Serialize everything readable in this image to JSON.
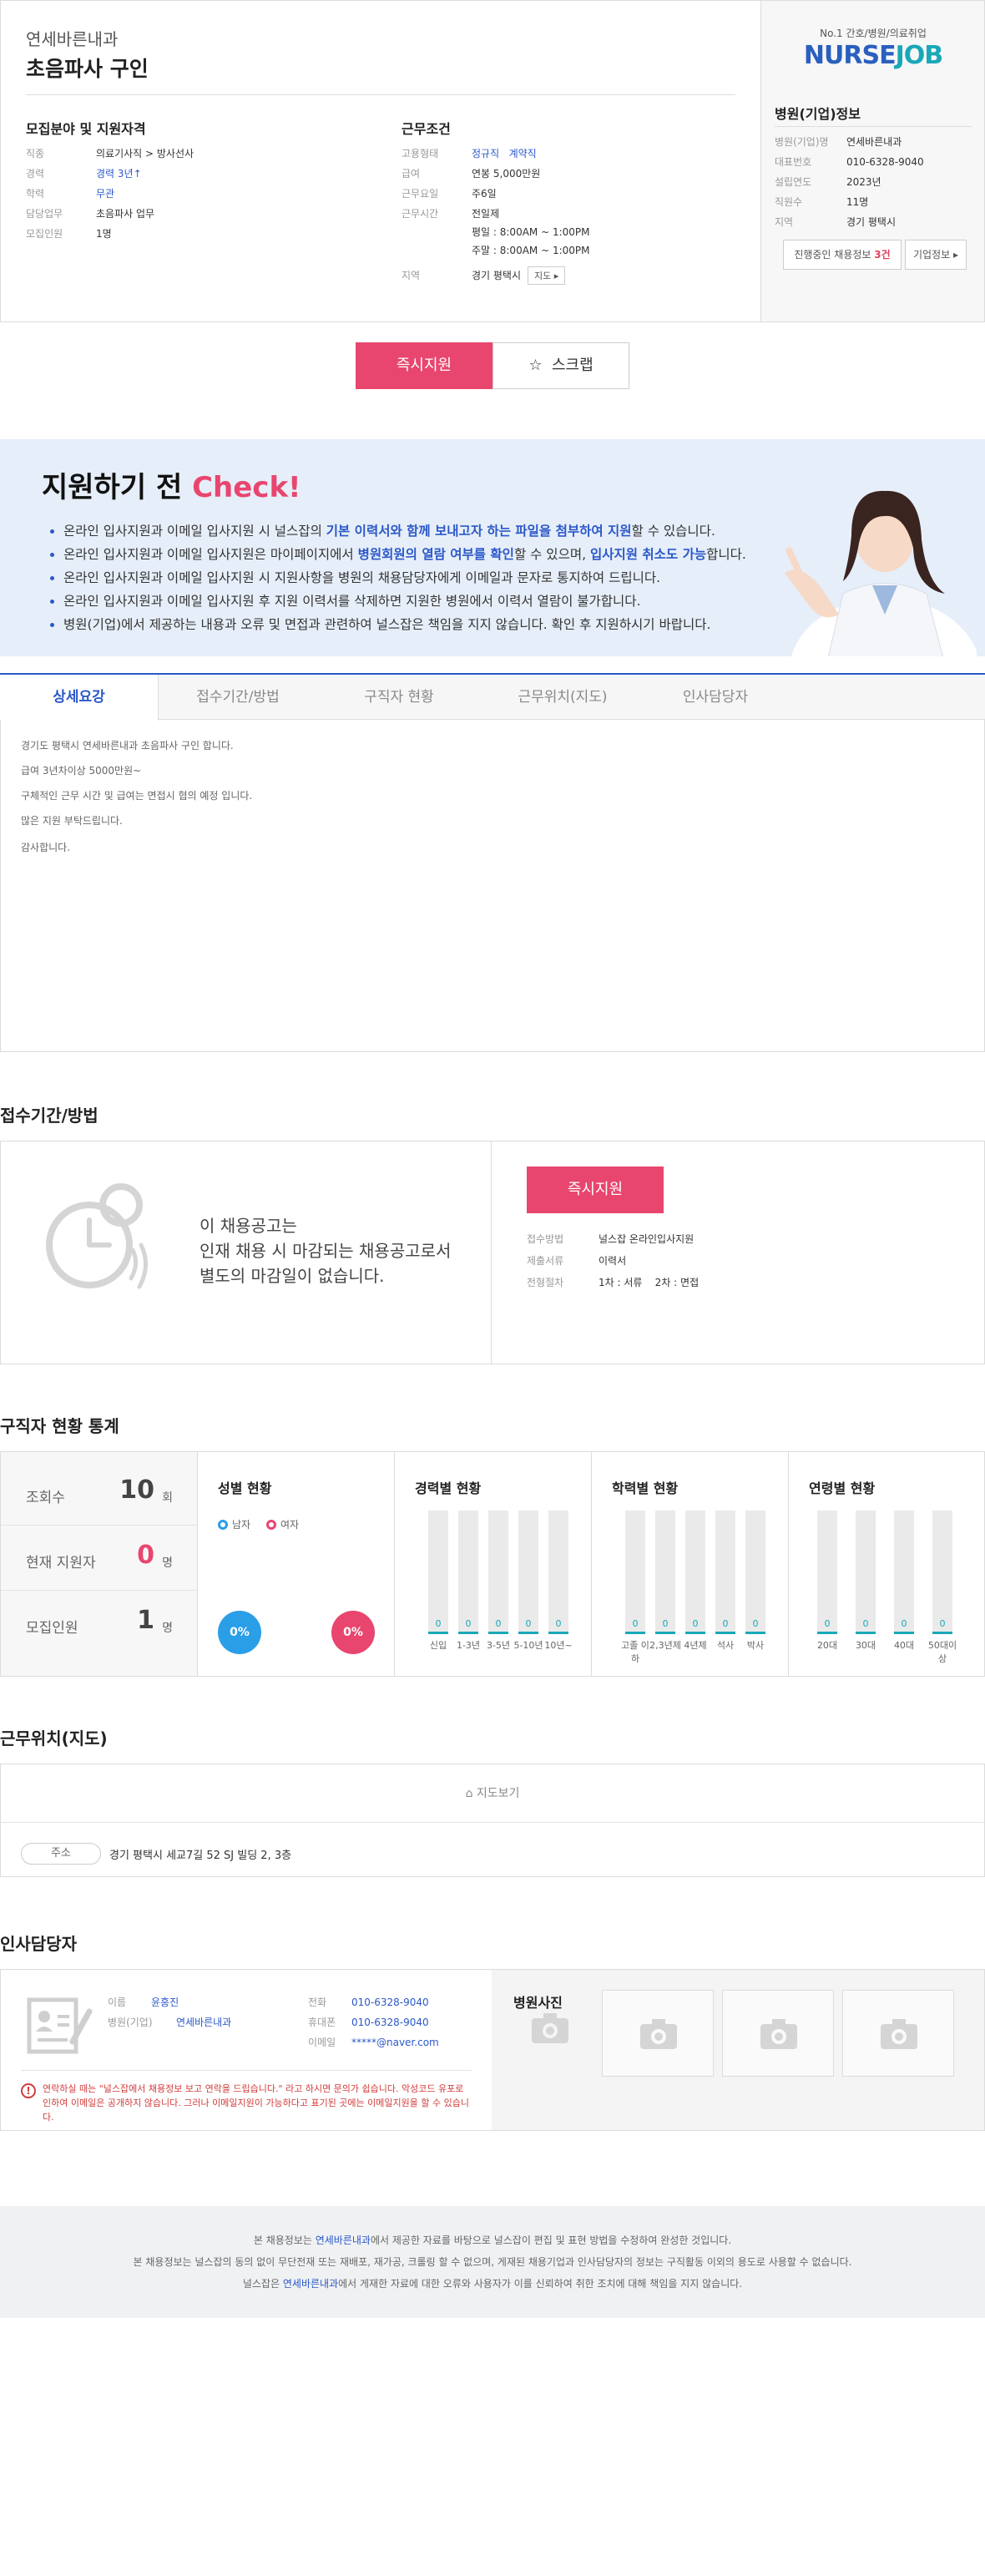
{
  "header": {
    "hospital_name": "연세바른내과",
    "job_title": "초음파사 구인"
  },
  "recruit": {
    "heading": "모집분야 및 지원자격",
    "rows": [
      {
        "label": "직종",
        "value": "의료기사직 > 방사선사"
      },
      {
        "label": "경력",
        "value": "경력 3년↑"
      },
      {
        "label": "학력",
        "value": "무관"
      },
      {
        "label": "담당업무",
        "value": "초음파사 업무"
      },
      {
        "label": "모집인원",
        "value": "1명"
      }
    ]
  },
  "conditions": {
    "heading": "근무조건",
    "type_label": "고용형태",
    "type_values": [
      "정규직",
      "계약직"
    ],
    "salary_label": "급여",
    "salary_value": "연봉 5,000만원",
    "days_label": "근무요일",
    "days_value": "주6일",
    "hours_label": "근무시간",
    "hours_values": [
      "전일제",
      "평일 : 8:00AM ~ 1:00PM",
      "주말 : 8:00AM ~ 1:00PM"
    ],
    "region_label": "지역",
    "region_value": "경기 평택시",
    "map_button": "지도 ▸"
  },
  "sidebar": {
    "brand_tagline": "No.1 간호/병원/의료취업",
    "brand_name_a": "NURSE",
    "brand_name_b": "JOB",
    "heading": "병원(기업)정보",
    "rows": [
      {
        "label": "병원(기업)명",
        "value": "연세바른내과"
      },
      {
        "label": "대표번호",
        "value": "010-6328-9040"
      },
      {
        "label": "설립연도",
        "value": "2023년"
      },
      {
        "label": "직원수",
        "value": "11명"
      },
      {
        "label": "지역",
        "value": "경기 평택시"
      }
    ],
    "btn_jobs_text": "진행중인 채용정보",
    "btn_jobs_count": "3건",
    "btn_company": "기업정보 ▸"
  },
  "actions": {
    "apply": "즉시지원",
    "scrap": "스크랩"
  },
  "check": {
    "heading_a": "지원하기 전 ",
    "heading_b": "Check!",
    "items": [
      [
        "온라인 입사지원과 이메일 입사지원 시 널스잡의 ",
        "기본 이력서와 함께 보내고자 하는 파일을 첨부하여 지원",
        "할 수 있습니다."
      ],
      [
        "온라인 입사지원과 이메일 입사지원은 마이페이지에서 ",
        "병원회원의 열람 여부를 확인",
        "할 수 있으며, ",
        "입사지원 취소도 가능",
        "합니다."
      ],
      [
        "온라인 입사지원과 이메일 입사지원 시 지원사항을 병원의 채용담당자에게 이메일과 문자로 통지하여 드립니다."
      ],
      [
        "온라인 입사지원과 이메일 입사지원 후 지원 이력서를 삭제하면 지원한 병원에서 이력서 열람이 불가합니다."
      ],
      [
        "병원(기업)에서 제공하는 내용과 오류 및 면접과 관련하여 널스잡은 책임을 지지 않습니다. 확인 후 지원하시기 바랍니다."
      ]
    ]
  },
  "tabs": [
    "상세요강",
    "접수기간/방법",
    "구직자 현황",
    "근무위치(지도)",
    "인사담당자"
  ],
  "detail_lines": [
    "경기도 평택시 연세바른내과 초음파사 구인 합니다.",
    "급여 3년차이상 5000만원~",
    "구체적인 근무 시간 및 급여는 면접시 협의 예정 입니다.",
    "많은 지원 부탁드립니다.",
    "감사합니다."
  ],
  "period": {
    "title": "접수기간/방법",
    "text_lines": [
      "이 채용공고는",
      "인재 채용 시 마감되는 채용공고로서",
      "별도의 마감일이 없습니다."
    ],
    "apply": "즉시지원",
    "rows": [
      {
        "label": "접수방법",
        "value": "널스잡 온라인입사지원"
      },
      {
        "label": "제출서류",
        "value": "이력서"
      },
      {
        "label": "전형절차",
        "value": "1차 : 서류    2차 : 면접"
      }
    ]
  },
  "stats": {
    "title": "구직자 현황 통계",
    "views_label": "조회수",
    "views": "10",
    "views_unit": "회",
    "applicants_label": "현재 지원자",
    "applicants": "0",
    "applicants_unit": "명",
    "recruit_label": "모집인원",
    "recruit": "1",
    "recruit_unit": "명",
    "gender_title": "성별 현황",
    "male_label": "남자",
    "female_label": "여자",
    "male_pct": "0%",
    "female_pct": "0%",
    "career_title": "경력별 현황",
    "career": [
      {
        "label": "신입",
        "value": "0"
      },
      {
        "label": "1-3년",
        "value": "0"
      },
      {
        "label": "3-5년",
        "value": "0"
      },
      {
        "label": "5-10년",
        "value": "0"
      },
      {
        "label": "10년~",
        "value": "0"
      }
    ],
    "edu_title": "학력별 현황",
    "edu": [
      {
        "label": "고졸 이하",
        "value": "0"
      },
      {
        "label": "2,3년제",
        "value": "0"
      },
      {
        "label": "4년제",
        "value": "0"
      },
      {
        "label": "석사",
        "value": "0"
      },
      {
        "label": "박사",
        "value": "0"
      }
    ],
    "age_title": "연령별 현황",
    "age": [
      {
        "label": "20대",
        "value": "0"
      },
      {
        "label": "30대",
        "value": "0"
      },
      {
        "label": "40대",
        "value": "0"
      },
      {
        "label": "50대이상",
        "value": "0"
      }
    ]
  },
  "map": {
    "title": "근무위치(지도)",
    "view_label": "지도보기",
    "addr_label": "주소",
    "address": "경기 평택시 세교7길 52 SJ 빌딩 2, 3층"
  },
  "hr": {
    "title": "인사담당자",
    "name_label": "이름",
    "name": "윤흥진",
    "company_label": "병원(기업)",
    "company": "연세바른내과",
    "phone_label": "전화",
    "phone": "010-6328-9040",
    "mobile_label": "휴대폰",
    "mobile": "010-6328-9040",
    "email_label": "이메일",
    "email": "*****@naver.com",
    "warning": "연락하실 때는 \"널스잡에서 채용정보 보고 연락을 드립습니다.\" 라고 하시면 문의가 쉽습니다. 악성코드 유포로 인하여 이메일은 공개하지 않습니다. 그러나 이메일지원이 가능하다고 표기된 곳에는 이메일지원을 할 수 있습니다.",
    "photo_title": "병원사진"
  },
  "footer": {
    "l1a": "본 채용정보는 ",
    "l1b": "연세바른내과",
    "l1c": "에서 제공한 자료를 바탕으로 널스잡이 편집 및 표현 방법을 수정하여 완성한 것입니다.",
    "l2": "본 채용정보는 널스잡의 동의 없이 무단전재 또는 재배포, 재가공, 크롤링 할 수 없으며, 게재된 채용기업과 인사담당자의 정보는 구직활동 이외의 용도로 사용할 수 없습니다.",
    "l3a": "널스잡은 ",
    "l3b": "연세바른내과",
    "l3c": "에서 게재한 자료에 대한 오류와 사용자가 이를 신뢰하여 취한 조치에 대해 책임을 지지 않습니다."
  }
}
